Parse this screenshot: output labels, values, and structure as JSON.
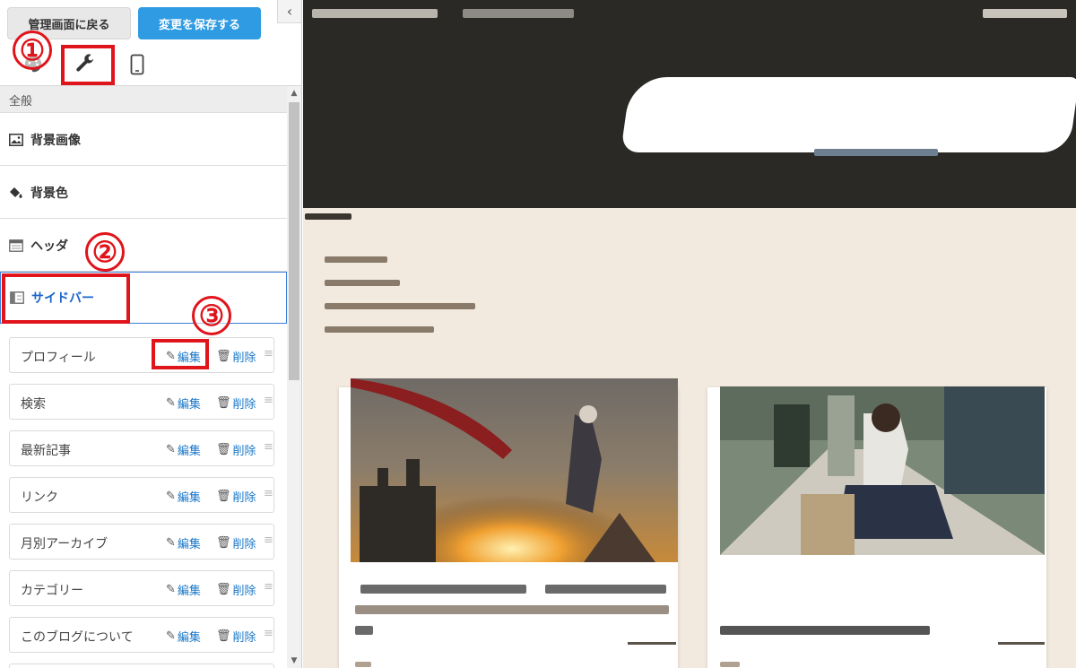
{
  "topbar": {
    "back_label": "管理画面に戻る",
    "save_label": "変更を保存する",
    "collapse_icon": "chevron-left-icon"
  },
  "tabs": [
    {
      "name": "design",
      "icon": "palette-icon"
    },
    {
      "name": "tools",
      "icon": "wrench-icon"
    },
    {
      "name": "mobile",
      "icon": "smartphone-icon"
    }
  ],
  "annotations": [
    "①",
    "②",
    "③"
  ],
  "section": {
    "title": "全般",
    "items": [
      {
        "label": "背景画像",
        "icon": "image-icon"
      },
      {
        "label": "背景色",
        "icon": "paint-bucket-icon"
      },
      {
        "label": "ヘッダ",
        "icon": "header-layout-icon"
      },
      {
        "label": "サイドバー",
        "icon": "sidebar-layout-icon",
        "active": true
      }
    ]
  },
  "widgets": {
    "edit_label": "編集",
    "delete_label": "削除",
    "items": [
      "プロフィール",
      "検索",
      "最新記事",
      "リンク",
      "月別アーカイブ",
      "カテゴリー",
      "このブログについて"
    ]
  },
  "colors": {
    "accent": "#2f9be3",
    "highlight": "#e0141b",
    "link": "#1a78c8",
    "preview_header": "#2b2925",
    "preview_bg": "#f3eadf"
  }
}
